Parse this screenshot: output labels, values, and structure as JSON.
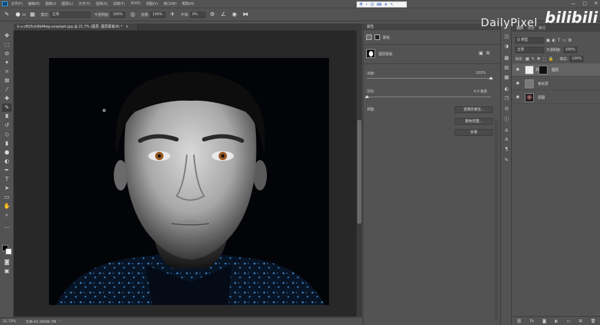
{
  "menu": {
    "logo": "Ps",
    "items": [
      "文件(F)",
      "编辑(E)",
      "图像(I)",
      "图层(L)",
      "文字(Y)",
      "选择(S)",
      "滤镜(T)",
      "3D(D)",
      "视图(V)",
      "窗口(W)",
      "帮助(H)"
    ]
  },
  "ime": {
    "items": [
      "英",
      "•",
      "☺",
      "⌨",
      "⚙",
      "✎"
    ]
  },
  "window_controls": {
    "minimize": "—",
    "maximize": "▢",
    "close": "✕"
  },
  "options": {
    "brush_size": "30",
    "mode_label": "模式:",
    "mode_value": "正常",
    "opacity_label": "不透明度:",
    "opacity_value": "100%",
    "flow_label": "流量:",
    "flow_value": "100%",
    "smooth_label": "平滑:",
    "smooth_value": "0%"
  },
  "document": {
    "tab_title": "k-u-cBQ5vhBbMwg-unsplash.jpg @ 21.7% (图层, 图层蒙版/8) *",
    "tab_close": "×"
  },
  "status": {
    "zoom": "21.72%",
    "doc_size": "文档:43.1M/96.7M"
  },
  "properties": {
    "tab": "属性",
    "pixel_mask_label": "蒙版",
    "layer_mask_label": "图层蒙版",
    "density_label": "浓度:",
    "density_value": "100%",
    "density": 100,
    "feather_label": "羽化:",
    "feather_value": "0.0 像素",
    "feather": 0,
    "adjust_label": "调整:",
    "buttons": [
      "选择并遮住...",
      "颜色范围...",
      "反相"
    ]
  },
  "layers": {
    "tabs": [
      "图层",
      "通道",
      "路径"
    ],
    "kind_filter": "Q 类型",
    "blend_mode": "正常",
    "opacity_label": "不透明度:",
    "opacity_value": "100%",
    "lock_label": "锁定:",
    "fill_label": "填充:",
    "fill_value": "100%",
    "items": [
      {
        "name": "图层",
        "selected": true
      },
      {
        "name": "锐化层",
        "selected": false
      },
      {
        "name": "原图",
        "selected": false
      }
    ]
  },
  "watermark": {
    "text": "DailyPixel",
    "logo": "bilibili"
  }
}
